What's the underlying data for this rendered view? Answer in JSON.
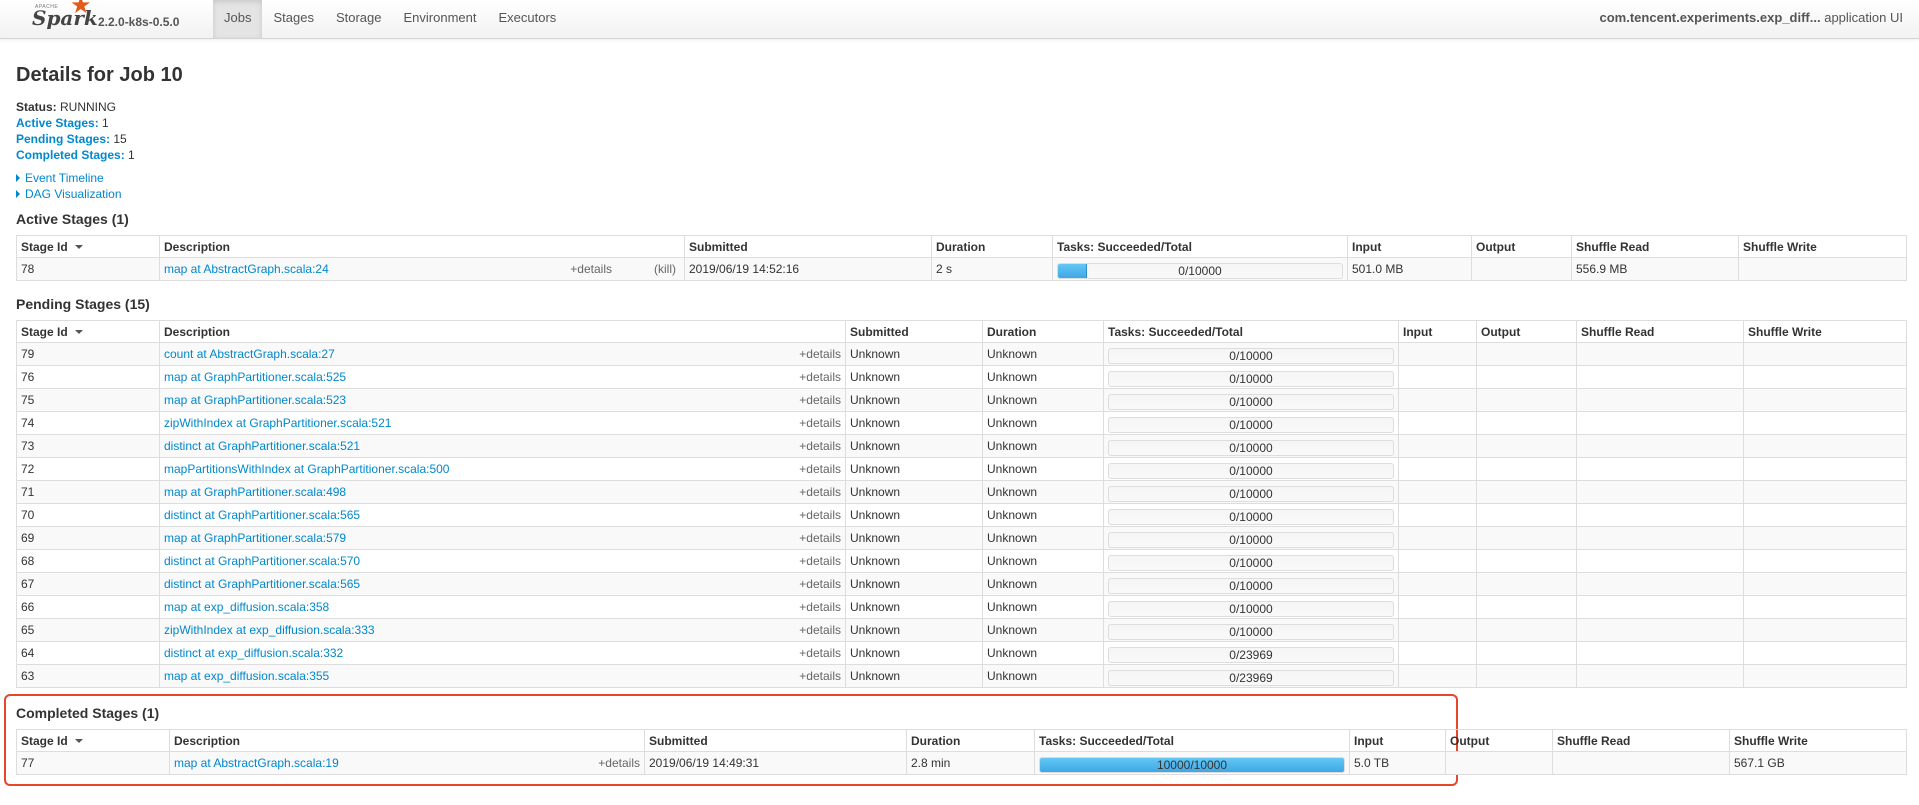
{
  "navbar": {
    "logo_apache": "APACHE",
    "logo_spark": "Spark",
    "version": "2.2.0-k8s-0.5.0",
    "tabs": [
      {
        "label": "Jobs",
        "active": true
      },
      {
        "label": "Stages",
        "active": false
      },
      {
        "label": "Storage",
        "active": false
      },
      {
        "label": "Environment",
        "active": false
      },
      {
        "label": "Executors",
        "active": false
      }
    ],
    "app_name": "com.tencent.experiments.exp_diff...",
    "app_suffix": "application UI"
  },
  "page": {
    "title": "Details for Job 10",
    "status_label": "Status:",
    "status_value": "RUNNING",
    "active_stages_label": "Active Stages:",
    "active_stages_value": "1",
    "pending_stages_label": "Pending Stages:",
    "pending_stages_value": "15",
    "completed_stages_label": "Completed Stages:",
    "completed_stages_value": "1",
    "event_timeline": "Event Timeline",
    "dag_visualization": "DAG Visualization"
  },
  "columns": [
    "Stage Id",
    "Description",
    "Submitted",
    "Duration",
    "Tasks: Succeeded/Total",
    "Input",
    "Output",
    "Shuffle Read",
    "Shuffle Write"
  ],
  "active": {
    "heading": "Active Stages (1)",
    "rows": [
      {
        "id": "78",
        "desc": "map at AbstractGraph.scala:24",
        "details": "+details",
        "kill": "(kill)",
        "submitted": "2019/06/19 14:52:16",
        "duration": "2 s",
        "tasks": "0/10000",
        "progress": 0.1,
        "input": "501.0 MB",
        "output": "",
        "shuffle_read": "556.9 MB",
        "shuffle_write": ""
      }
    ]
  },
  "pending": {
    "heading": "Pending Stages (15)",
    "rows": [
      {
        "id": "79",
        "desc": "count at AbstractGraph.scala:27",
        "details": "+details",
        "submitted": "Unknown",
        "duration": "Unknown",
        "tasks": "0/10000",
        "progress": 0
      },
      {
        "id": "76",
        "desc": "map at GraphPartitioner.scala:525",
        "details": "+details",
        "submitted": "Unknown",
        "duration": "Unknown",
        "tasks": "0/10000",
        "progress": 0
      },
      {
        "id": "75",
        "desc": "map at GraphPartitioner.scala:523",
        "details": "+details",
        "submitted": "Unknown",
        "duration": "Unknown",
        "tasks": "0/10000",
        "progress": 0
      },
      {
        "id": "74",
        "desc": "zipWithIndex at GraphPartitioner.scala:521",
        "details": "+details",
        "submitted": "Unknown",
        "duration": "Unknown",
        "tasks": "0/10000",
        "progress": 0
      },
      {
        "id": "73",
        "desc": "distinct at GraphPartitioner.scala:521",
        "details": "+details",
        "submitted": "Unknown",
        "duration": "Unknown",
        "tasks": "0/10000",
        "progress": 0
      },
      {
        "id": "72",
        "desc": "mapPartitionsWithIndex at GraphPartitioner.scala:500",
        "details": "+details",
        "submitted": "Unknown",
        "duration": "Unknown",
        "tasks": "0/10000",
        "progress": 0
      },
      {
        "id": "71",
        "desc": "map at GraphPartitioner.scala:498",
        "details": "+details",
        "submitted": "Unknown",
        "duration": "Unknown",
        "tasks": "0/10000",
        "progress": 0
      },
      {
        "id": "70",
        "desc": "distinct at GraphPartitioner.scala:565",
        "details": "+details",
        "submitted": "Unknown",
        "duration": "Unknown",
        "tasks": "0/10000",
        "progress": 0
      },
      {
        "id": "69",
        "desc": "map at GraphPartitioner.scala:579",
        "details": "+details",
        "submitted": "Unknown",
        "duration": "Unknown",
        "tasks": "0/10000",
        "progress": 0
      },
      {
        "id": "68",
        "desc": "distinct at GraphPartitioner.scala:570",
        "details": "+details",
        "submitted": "Unknown",
        "duration": "Unknown",
        "tasks": "0/10000",
        "progress": 0
      },
      {
        "id": "67",
        "desc": "distinct at GraphPartitioner.scala:565",
        "details": "+details",
        "submitted": "Unknown",
        "duration": "Unknown",
        "tasks": "0/10000",
        "progress": 0
      },
      {
        "id": "66",
        "desc": "map at exp_diffusion.scala:358",
        "details": "+details",
        "submitted": "Unknown",
        "duration": "Unknown",
        "tasks": "0/10000",
        "progress": 0
      },
      {
        "id": "65",
        "desc": "zipWithIndex at exp_diffusion.scala:333",
        "details": "+details",
        "submitted": "Unknown",
        "duration": "Unknown",
        "tasks": "0/10000",
        "progress": 0
      },
      {
        "id": "64",
        "desc": "distinct at exp_diffusion.scala:332",
        "details": "+details",
        "submitted": "Unknown",
        "duration": "Unknown",
        "tasks": "0/23969",
        "progress": 0
      },
      {
        "id": "63",
        "desc": "map at exp_diffusion.scala:355",
        "details": "+details",
        "submitted": "Unknown",
        "duration": "Unknown",
        "tasks": "0/23969",
        "progress": 0
      }
    ]
  },
  "completed": {
    "heading": "Completed Stages (1)",
    "rows": [
      {
        "id": "77",
        "desc": "map at AbstractGraph.scala:19",
        "details": "+details",
        "submitted": "2019/06/19 14:49:31",
        "duration": "2.8 min",
        "tasks": "10000/10000",
        "progress": 1.0,
        "input": "5.0 TB",
        "output": "",
        "shuffle_read": "",
        "shuffle_write": "567.1 GB"
      }
    ]
  },
  "colors": {
    "accent": "#0088cc",
    "progress": "#3fa7e7",
    "highlight": "#e8462b"
  }
}
